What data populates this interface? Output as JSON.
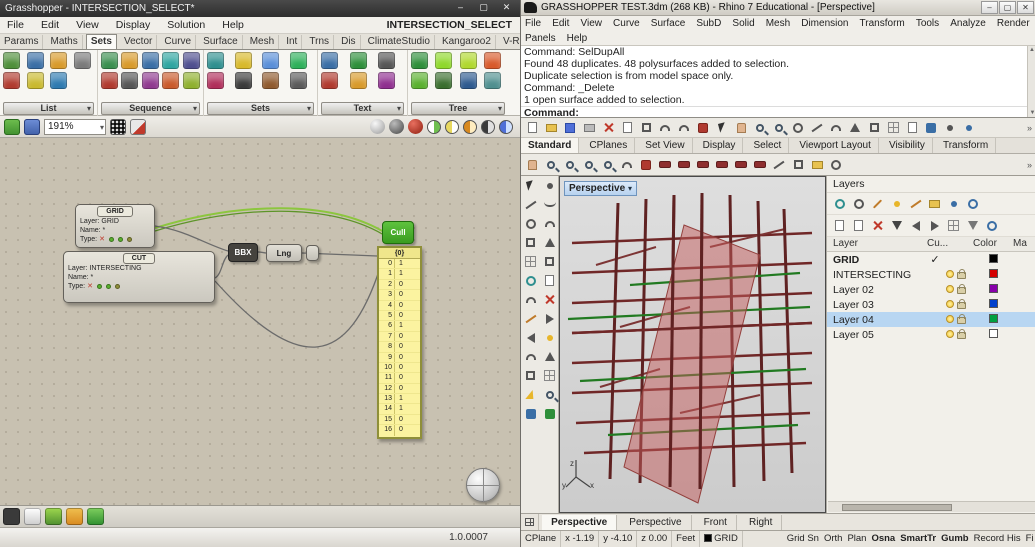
{
  "icons": {
    "minimize": "–",
    "maximize": "▢",
    "close": "✕",
    "caret_down": "▾",
    "chevron_more": "»",
    "check": "✓",
    "x_mark": "✕",
    "scroll_up": "▲",
    "scroll_down": "▼"
  },
  "grasshopper": {
    "window_title": "Grasshopper - INTERSECTION_SELECT*",
    "menu": [
      "File",
      "Edit",
      "View",
      "Display",
      "Solution",
      "Help"
    ],
    "doc_label": "INTERSECTION_SELECT",
    "tabs": [
      "Params",
      "Maths",
      "Sets",
      "Vector",
      "Curve",
      "Surface",
      "Mesh",
      "Int",
      "Trns",
      "Dis",
      "ClimateStudio",
      "Kangaroo2",
      "V-Ray"
    ],
    "active_tab": "Sets",
    "palette_groups": [
      "List",
      "Sequence",
      "Sets",
      "Text",
      "Tree"
    ],
    "zoom_level": "191%",
    "canvas": {
      "grid_node": {
        "title": "GRID",
        "layer_row": "Layer:  GRID",
        "name_row": "Name:  *",
        "type_row": "Type:"
      },
      "cut_node": {
        "title": "CUT",
        "layer_row": "Layer:  INTERSECTING",
        "name_row": "Name:  *",
        "type_row": "Type:"
      },
      "bbx_label": "BBX",
      "lng_label": "Lng",
      "cull_label": "Cull",
      "panel": {
        "header": "{0}",
        "rows": [
          {
            "i": "0",
            "v": "1"
          },
          {
            "i": "1",
            "v": "1"
          },
          {
            "i": "2",
            "v": "0"
          },
          {
            "i": "3",
            "v": "0"
          },
          {
            "i": "4",
            "v": "0"
          },
          {
            "i": "5",
            "v": "0"
          },
          {
            "i": "6",
            "v": "1"
          },
          {
            "i": "7",
            "v": "0"
          },
          {
            "i": "8",
            "v": "0"
          },
          {
            "i": "9",
            "v": "0"
          },
          {
            "i": "10",
            "v": "0"
          },
          {
            "i": "11",
            "v": "0"
          },
          {
            "i": "12",
            "v": "0"
          },
          {
            "i": "13",
            "v": "1"
          },
          {
            "i": "14",
            "v": "1"
          },
          {
            "i": "15",
            "v": "0"
          },
          {
            "i": "16",
            "v": "0"
          }
        ]
      }
    },
    "version": "1.0.0007"
  },
  "rhino": {
    "window_title": "GRASSHOPPER TEST.3dm (268 KB) - Rhino 7 Educational - [Perspective]",
    "menu": [
      "File",
      "Edit",
      "View",
      "Curve",
      "Surface",
      "SubD",
      "Solid",
      "Mesh",
      "Dimension",
      "Transform",
      "Tools",
      "Analyze",
      "Render"
    ],
    "menu2": [
      "Panels",
      "Help"
    ],
    "command_history": [
      "Command: SelDupAll",
      "Found 48 duplicates. 48 polysurfaces added to selection.",
      "Duplicate selection is from model space only.",
      "Command: _Delete",
      "1 open surface added to selection."
    ],
    "command_prompt": "Command:",
    "toolbar_tabs": [
      "Standard",
      "CPlanes",
      "Set View",
      "Display",
      "Select",
      "Viewport Layout",
      "Visibility",
      "Transform"
    ],
    "active_toolbar_tab": "Standard",
    "viewport": {
      "label": "Perspective",
      "axis_x": "x",
      "axis_y": "y",
      "axis_z": "z"
    },
    "layers_panel": {
      "title": "Layers",
      "columns": [
        "Layer",
        "Cu...",
        "Color",
        "Ma"
      ],
      "rows": [
        {
          "name": "GRID",
          "current": true,
          "selected": false,
          "color": "#000000"
        },
        {
          "name": "INTERSECTING",
          "current": false,
          "selected": false,
          "color": "#d40000"
        },
        {
          "name": "Layer 02",
          "current": false,
          "selected": false,
          "color": "#8800aa"
        },
        {
          "name": "Layer 03",
          "current": false,
          "selected": false,
          "color": "#0040cc"
        },
        {
          "name": "Layer 04",
          "current": false,
          "selected": true,
          "color": "#00a040"
        },
        {
          "name": "Layer 05",
          "current": false,
          "selected": false,
          "color": "#ffffff"
        }
      ]
    },
    "viewport_tabs": [
      "Perspective",
      "Perspective",
      "Front",
      "Right"
    ],
    "status_bar": {
      "cplane": "CPlane",
      "x": "x -1.19",
      "y": "y -4.10",
      "z": "z 0.00",
      "units": "Feet",
      "layer": "GRID",
      "toggles": [
        {
          "label": "Grid Sn",
          "on": false
        },
        {
          "label": "Orth",
          "on": false
        },
        {
          "label": "Plan",
          "on": false
        },
        {
          "label": "Osna",
          "on": true
        },
        {
          "label": "SmartTr",
          "on": true
        },
        {
          "label": "Gumb",
          "on": true
        },
        {
          "label": "Record His",
          "on": false
        },
        {
          "label": "Fi",
          "on": false
        }
      ]
    }
  }
}
